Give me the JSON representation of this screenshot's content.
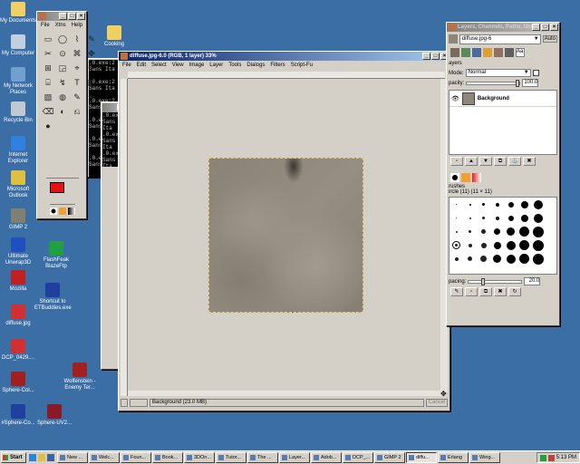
{
  "desktop_icons": [
    {
      "label": "My Documents",
      "icon": "folder-icon",
      "color": "#f0d060"
    },
    {
      "label": "My Computer",
      "icon": "computer-icon",
      "color": "#c0d0e0"
    },
    {
      "label": "My Network Places",
      "icon": "network-icon",
      "color": "#70a0d0"
    },
    {
      "label": "Recycle Bin",
      "icon": "recycle-bin-icon",
      "color": "#c0c8d0"
    },
    {
      "label": "Internet Explorer",
      "icon": "internet-explorer-icon",
      "color": "#3080e0"
    },
    {
      "label": "Microsoft Outlook",
      "icon": "outlook-icon",
      "color": "#e0c040"
    },
    {
      "label": "GIMP 2",
      "icon": "gimp-icon",
      "color": "#808070"
    },
    {
      "label": "Ultimate Unwrap3D",
      "icon": "unwrap3d-icon",
      "color": "#2050c0"
    },
    {
      "label": "Mozilla",
      "icon": "mozilla-icon",
      "color": "#c02020"
    },
    {
      "label": "diffuse.jpg",
      "icon": "image-file-icon",
      "color": "#d03030"
    },
    {
      "label": "DCP_0429....",
      "icon": "image-file-icon",
      "color": "#d03030"
    },
    {
      "label": "Sphere-Col...",
      "icon": "sphere-icon",
      "color": "#a02020"
    },
    {
      "label": "#Sphere-Co...",
      "icon": "sphere-icon",
      "color": "#2040a0"
    },
    {
      "label": "Sphere-UV2...",
      "icon": "sphere-icon",
      "color": "#8a1a2a"
    },
    {
      "label": "FlashFeak BlazeFtp",
      "icon": "ftp-icon",
      "color": "#20a040"
    },
    {
      "label": "Shortcut to ETBuddies.exe",
      "icon": "etbuddies-icon",
      "color": "#2040a0"
    },
    {
      "label": "Wolfenstein - Enemy Ter...",
      "icon": "wolfenstein-icon",
      "color": "#a02020"
    },
    {
      "label": "Cooking",
      "icon": "folder-icon",
      "color": "#f0d060"
    }
  ],
  "toolbox": {
    "menu": [
      "File",
      "Xtns",
      "Help"
    ],
    "tools": [
      "▭",
      "◯",
      "⌇",
      "✎",
      "✂",
      "⊙",
      "⌘",
      "✥",
      "⊞",
      "◲",
      "⌖",
      "✢",
      "⌸",
      "↯",
      "T",
      "◧",
      "▨",
      "◍",
      "✎",
      "✒",
      "⌫",
      "◐",
      "⎌",
      "∴",
      "●"
    ],
    "fg_color": "#e81010",
    "bg_color": "#ffffff"
  },
  "terminal": {
    "lines": [
      ".0.exe:2",
      "Sans Ita",
      "",
      ".0.exe:2",
      "Sans Ita",
      "",
      ".0.exe:2",
      "Sans Ita",
      "",
      ".0.exe:2",
      "Sans Ita",
      "",
      ".0.exe:2",
      "Sans Ita",
      "",
      ".0.exe:2",
      "Sans Ita"
    ]
  },
  "image_window": {
    "title": "diffuse.jpg-6.0 (RGB, 1 layer) 33%",
    "menu": [
      "File",
      "Edit",
      "Select",
      "View",
      "Image",
      "Layer",
      "Tools",
      "Dialogs",
      "Filters",
      "Script-Fu"
    ],
    "status": "Background (23.0 MB)",
    "cancel": "Cancel",
    "canvas_color": "#8f867a"
  },
  "layers_dock": {
    "title": "Layers, Channels, Paths, Undo...",
    "image_select": "diffuse.jpg-6",
    "auto_label": "Auto",
    "layers_header": "ayers",
    "mode_label": "Mode:",
    "mode_value": "Normal",
    "opacity_label": "pacity:",
    "opacity_value": "100.0",
    "layer_name": "Background",
    "brushes_header": "rushes",
    "brush_name": "ircle (11) (11 × 11)",
    "spacing_label": "pacing:",
    "spacing_value": "20.0"
  },
  "taskbar": {
    "start": "Start",
    "items": [
      "New ...",
      "Welc...",
      "Foun...",
      "Book...",
      "3DOn...",
      "Tutor...",
      "The ...",
      "Layer...",
      "Adob...",
      "DCP_...",
      "GIMP 2",
      "diffu...",
      "Erlang",
      "Wing..."
    ],
    "active_index": 11,
    "clock": "5:13 PM"
  }
}
